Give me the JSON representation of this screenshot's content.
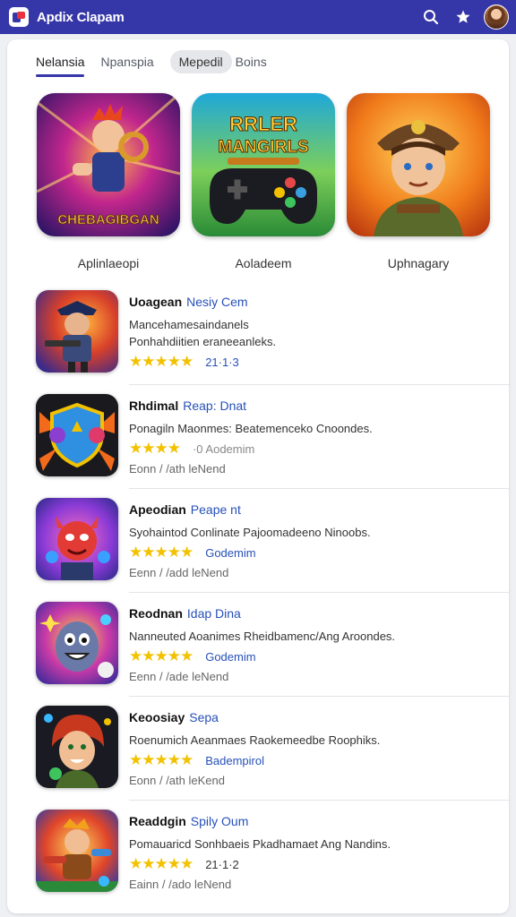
{
  "header": {
    "title": "Apdix Clapam",
    "logo_icon": "app-logo-icon",
    "search_icon": "search-icon",
    "favorite_icon": "star-icon",
    "avatar_icon": "user-avatar",
    "bar_color": "#3536a8"
  },
  "tabs": [
    {
      "label": "Nelansia",
      "active": true
    },
    {
      "label": "Npanspia",
      "active": false
    },
    {
      "label": "Mepedil",
      "active": false
    },
    {
      "label": "Boins",
      "active": false
    }
  ],
  "featured": [
    {
      "label": "Aplinlaeopi",
      "icon": "hero-game-icon",
      "art_text": "CHEBAGIBGAN"
    },
    {
      "label": "Aoladeem",
      "icon": "gamepad-icon",
      "art_text": "RRLER MANGIRLS"
    },
    {
      "label": "Uphnagary",
      "icon": "adventurer-icon"
    }
  ],
  "apps": [
    {
      "title": "Uoagean",
      "accent": "Nesiy Cem",
      "desc1": "Mancehamesaindanels",
      "desc2": "Ponhahdiitien eraneeanleks.",
      "stars": "★★★★★",
      "rating": "21·1·3",
      "footer": "",
      "icon": "soldier-icon"
    },
    {
      "title": "Rhdimal",
      "accent": "Reap: Dnat",
      "desc1": "Ponagiln Maonmes: Beatemenceko Cnoondes.",
      "desc2": "",
      "stars": "★★★★",
      "rating": "·0 Aodemim",
      "footer": "Eonn / /ath leNend",
      "icon": "shield-icon"
    },
    {
      "title": "Apeodian",
      "accent": "Peape nt",
      "desc1": "Syohaintod Conlinate Pajoomadeeno Ninoobs.",
      "desc2": "",
      "stars": "★★★★★",
      "rating": "Godemim",
      "footer": "Eenn / /add leNend",
      "icon": "devil-icon"
    },
    {
      "title": "Reodnan",
      "accent": "Idap Dina",
      "desc1": "Nanneuted Aoanimes Rheidbamenc/Ang Aroondes.",
      "desc2": "",
      "stars": "★★★★★",
      "rating": "Godemim",
      "footer": "Eenn / /ade leNend",
      "icon": "ghost-icon"
    },
    {
      "title": "Keoosiay",
      "accent": "Sepa",
      "desc1": "Roenumich Aeanmaes Raokemeedbe Roophiks.",
      "desc2": "",
      "stars": "★★★★★",
      "rating": "Badempirol",
      "footer": "Eonn / /ath leKend",
      "icon": "redhead-icon"
    },
    {
      "title": "Readdgin",
      "accent": "Spily Oum",
      "desc1": "Pomauaricd Sonhbaeis Pkadhamaet Ang Nandins.",
      "desc2": "",
      "stars": "★★★★★",
      "rating": "21·1·2",
      "footer": "Eainn / /ado leNend",
      "icon": "warrior-icon"
    }
  ]
}
